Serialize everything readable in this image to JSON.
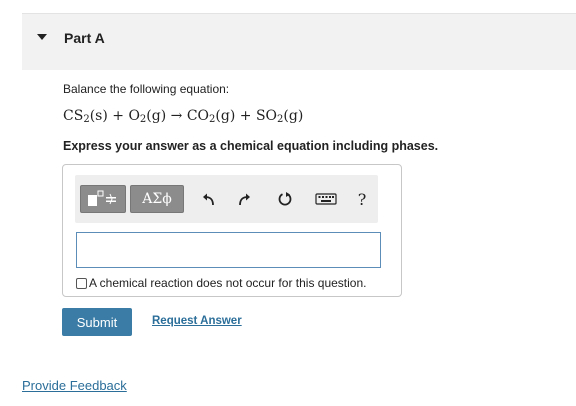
{
  "part": {
    "title": "Part A"
  },
  "question": {
    "instruction": "Balance the following equation:",
    "equation": {
      "r1": "CS",
      "r1_sub": "2",
      "r1_phase": "(s)",
      "plus1": "+",
      "r2": "O",
      "r2_sub": "2",
      "r2_phase": "(g)",
      "arrow": "→",
      "p1": "CO",
      "p1_sub": "2",
      "p1_phase": "(g)",
      "plus2": "+",
      "p2": "SO",
      "p2_sub": "2",
      "p2_phase": "(g)"
    },
    "express": "Express your answer as a chemical equation including phases."
  },
  "toolbar": {
    "greek_label": "ΑΣϕ",
    "help_label": "?",
    "icons": [
      "templates-icon",
      "undo-icon",
      "redo-icon",
      "reset-icon",
      "keyboard-icon"
    ]
  },
  "answer": {
    "value": "",
    "no_reaction_label": "A chemical reaction does not occur for this question.",
    "no_reaction_checked": false
  },
  "actions": {
    "submit_label": "Submit",
    "request_label": "Request Answer",
    "feedback_label": "Provide Feedback"
  },
  "colors": {
    "accent": "#3a7ca5",
    "link": "#2b6e99",
    "header_bg": "#f2f2f2",
    "toolbar_button": "#8c8c8c"
  }
}
